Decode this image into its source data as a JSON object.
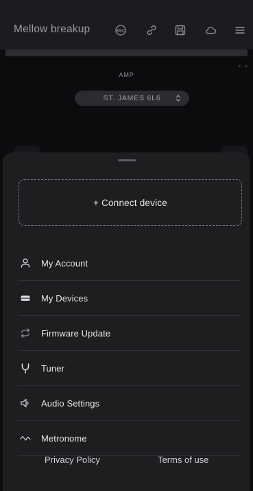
{
  "app": {
    "title": "Mellow breakup",
    "icons": [
      "rec-icon",
      "link-icon",
      "save-icon",
      "cloud-icon",
      "menu-icon"
    ]
  },
  "amp": {
    "label": "AMP",
    "corner": "< >",
    "selected_model": "ST. JAMES 6L6"
  },
  "sheet": {
    "connect_label": "+ Connect device",
    "menu": [
      {
        "label": "My Account",
        "icon": "user-icon"
      },
      {
        "label": "My Devices",
        "icon": "device-icon"
      },
      {
        "label": "Firmware Update",
        "icon": "sync-icon"
      },
      {
        "label": "Tuner",
        "icon": "tuning-fork-icon"
      },
      {
        "label": "Audio Settings",
        "icon": "speaker-icon"
      },
      {
        "label": "Metronome",
        "icon": "wave-icon"
      }
    ],
    "footer": {
      "privacy": "Privacy Policy",
      "terms": "Terms of use"
    }
  },
  "colors": {
    "background": "#0b0c0e",
    "topbar": "#1b1c1f",
    "sheet": "#1d1e20",
    "text_primary": "#e4e5e7",
    "text_muted": "#9a9ca1"
  }
}
